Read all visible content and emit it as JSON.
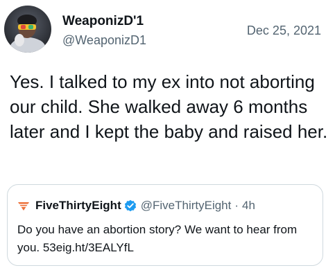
{
  "author": {
    "display_name": "WeaponizD'1",
    "handle": "@WeaponizD1",
    "avatar_icon": "profile-photo"
  },
  "date": "Dec 25, 2021",
  "text": "Yes. I talked to my ex into not aborting our child. She walked away 6 months later and I kept the baby and raised her.",
  "quoted_tweet": {
    "logo_icon": "fivethirtyeight-logo-icon",
    "display_name": "FiveThirtyEight",
    "verified_icon": "verified-badge-icon",
    "handle": "@FiveThirtyEight",
    "separator": "·",
    "time": "4h",
    "text": "Do you have an abortion story? We want to hear from you. 53eig.ht/3EALYfL"
  },
  "colors": {
    "text_primary": "#0f1419",
    "text_secondary": "#536471",
    "verified_blue": "#1d9bf0",
    "fte_orange": "#ed713a",
    "border": "#cfd9de"
  }
}
